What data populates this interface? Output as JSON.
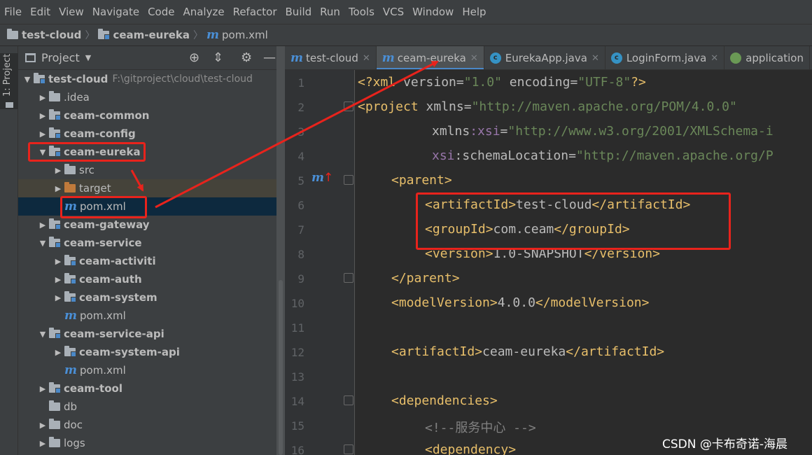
{
  "menu": [
    "File",
    "Edit",
    "View",
    "Navigate",
    "Code",
    "Analyze",
    "Refactor",
    "Build",
    "Run",
    "Tools",
    "VCS",
    "Window",
    "Help"
  ],
  "breadcrumb": [
    "test-cloud",
    "ceam-eureka",
    "pom.xml"
  ],
  "sidebar_stripe_label": "1: Project",
  "project_panel": {
    "title": "Project",
    "tree": [
      {
        "label": "test-cloud",
        "path": "F:\\gitproject\\cloud\\test-cloud"
      },
      {
        "label": ".idea"
      },
      {
        "label": "ceam-common"
      },
      {
        "label": "ceam-config"
      },
      {
        "label": "ceam-eureka"
      },
      {
        "label": "src"
      },
      {
        "label": "target"
      },
      {
        "label": "pom.xml"
      },
      {
        "label": "ceam-gateway"
      },
      {
        "label": "ceam-service"
      },
      {
        "label": "ceam-activiti"
      },
      {
        "label": "ceam-auth"
      },
      {
        "label": "ceam-system"
      },
      {
        "label": "pom.xml"
      },
      {
        "label": "ceam-service-api"
      },
      {
        "label": "ceam-system-api"
      },
      {
        "label": "pom.xml"
      },
      {
        "label": "ceam-tool"
      },
      {
        "label": "db"
      },
      {
        "label": "doc"
      },
      {
        "label": "logs"
      }
    ]
  },
  "tabs": [
    {
      "label": "test-cloud"
    },
    {
      "label": "ceam-eureka"
    },
    {
      "label": "EurekaApp.java"
    },
    {
      "label": "LoginForm.java"
    },
    {
      "label": "application"
    }
  ],
  "line_numbers": [
    "1",
    "2",
    "3",
    "4",
    "5",
    "6",
    "7",
    "8",
    "9",
    "10",
    "11",
    "12",
    "13",
    "14",
    "15",
    "16"
  ],
  "code": {
    "l1": {
      "p1": "<?xml",
      "p2": " version=",
      "p3": "\"1.0\"",
      "p4": " encoding=",
      "p5": "\"UTF-8\"",
      "p6": "?>"
    },
    "l2": {
      "p1": "<project",
      "p2": " xmlns=",
      "p3": "\"http://maven.apache.org/POM/4.0.0\""
    },
    "l3": {
      "p1": "xmlns",
      "p2": ":xsi",
      "p3": "=",
      "p4": "\"http://www.w3.org/2001/XMLSchema-i"
    },
    "l4": {
      "p1": "xsi",
      "p2": ":schemaLocation=",
      "p3": "\"http://maven.apache.org/P"
    },
    "l5": {
      "p1": "<parent>"
    },
    "l6": {
      "p1": "<artifactId>",
      "p2": "test-cloud",
      "p3": "</artifactId>"
    },
    "l7": {
      "p1": "<groupId>",
      "p2": "com.ceam",
      "p3": "</groupId>"
    },
    "l8": {
      "p1": "<version>",
      "p2": "1.0-SNAPSHOT",
      "p3": "</version>"
    },
    "l9": {
      "p1": "</parent>"
    },
    "l10": {
      "p1": "<modelVersion>",
      "p2": "4.0.0",
      "p3": "</modelVersion>"
    },
    "l12": {
      "p1": "<artifactId>",
      "p2": "ceam-eureka",
      "p3": "</artifactId>"
    },
    "l14": {
      "p1": "<dependencies>"
    },
    "l15": {
      "p1": "<!--服务中心 -->"
    },
    "l16": {
      "p1": "<dependency>"
    }
  },
  "watermark": "CSDN @卡布奇诺-海晨",
  "colors": {
    "annotation_red": "#e8231c",
    "tag": "#e8bf6a",
    "string": "#6a8759",
    "selection": "#0d293e"
  }
}
